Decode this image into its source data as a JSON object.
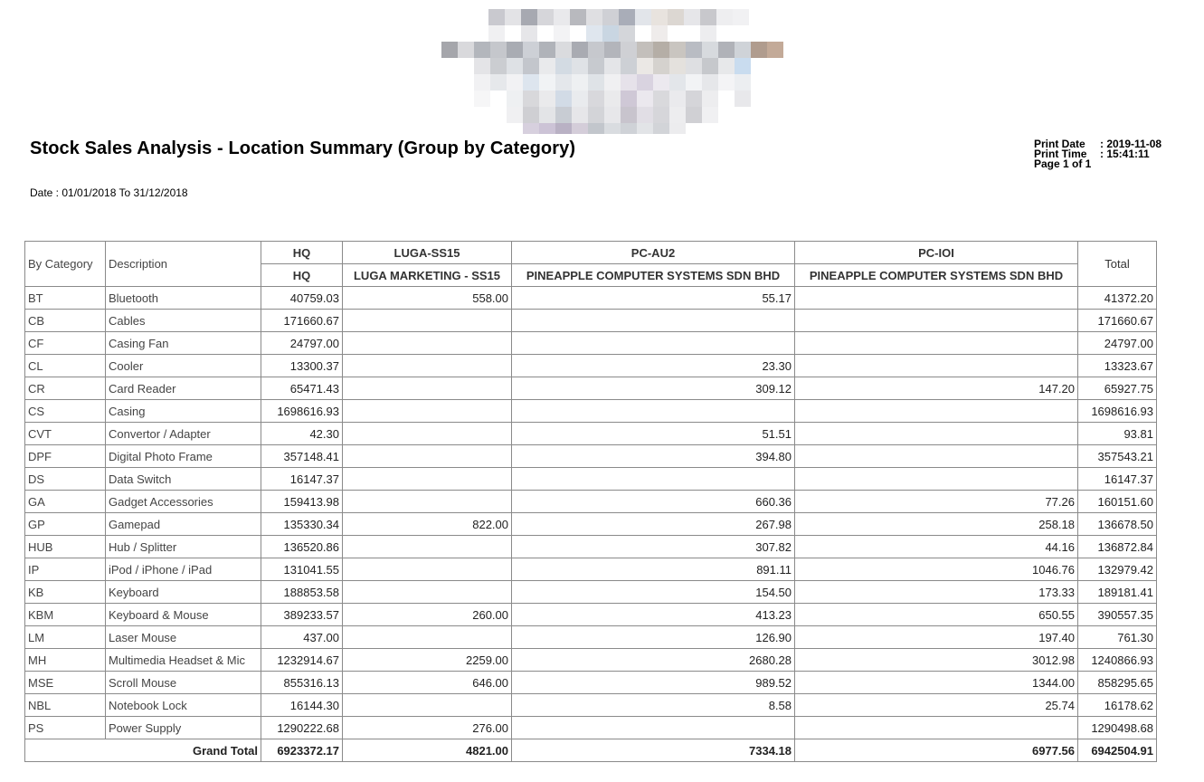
{
  "report": {
    "title": "Stock Sales Analysis - Location Summary (Group by Category)",
    "date_range": "Date : 01/01/2018 To 31/12/2018",
    "print_date_label": "Print Date",
    "print_date_value": ": 2019-11-08",
    "print_time_label": "Print Time",
    "print_time_value": ": 15:41:11",
    "page": "Page 1 of 1"
  },
  "table": {
    "col_category": "By Category",
    "col_description": "Description",
    "col_total": "Total",
    "locations": [
      {
        "code": "HQ",
        "name": "HQ"
      },
      {
        "code": "LUGA-SS15",
        "name": "LUGA MARKETING - SS15"
      },
      {
        "code": "PC-AU2",
        "name": "PINEAPPLE COMPUTER SYSTEMS SDN BHD"
      },
      {
        "code": "PC-IOI",
        "name": "PINEAPPLE COMPUTER SYSTEMS SDN BHD"
      }
    ],
    "rows": [
      {
        "code": "BT",
        "desc": "Bluetooth",
        "hq": "40759.03",
        "luga": "558.00",
        "au2": "55.17",
        "ioi": "",
        "total": "41372.20"
      },
      {
        "code": "CB",
        "desc": "Cables",
        "hq": "171660.67",
        "luga": "",
        "au2": "",
        "ioi": "",
        "total": "171660.67"
      },
      {
        "code": "CF",
        "desc": "Casing Fan",
        "hq": "24797.00",
        "luga": "",
        "au2": "",
        "ioi": "",
        "total": "24797.00"
      },
      {
        "code": "CL",
        "desc": "Cooler",
        "hq": "13300.37",
        "luga": "",
        "au2": "23.30",
        "ioi": "",
        "total": "13323.67"
      },
      {
        "code": "CR",
        "desc": "Card Reader",
        "hq": "65471.43",
        "luga": "",
        "au2": "309.12",
        "ioi": "147.20",
        "total": "65927.75"
      },
      {
        "code": "CS",
        "desc": "Casing",
        "hq": "1698616.93",
        "luga": "",
        "au2": "",
        "ioi": "",
        "total": "1698616.93"
      },
      {
        "code": "CVT",
        "desc": "Convertor / Adapter",
        "hq": "42.30",
        "luga": "",
        "au2": "51.51",
        "ioi": "",
        "total": "93.81"
      },
      {
        "code": "DPF",
        "desc": "Digital Photo Frame",
        "hq": "357148.41",
        "luga": "",
        "au2": "394.80",
        "ioi": "",
        "total": "357543.21"
      },
      {
        "code": "DS",
        "desc": "Data Switch",
        "hq": "16147.37",
        "luga": "",
        "au2": "",
        "ioi": "",
        "total": "16147.37"
      },
      {
        "code": "GA",
        "desc": "Gadget Accessories",
        "hq": "159413.98",
        "luga": "",
        "au2": "660.36",
        "ioi": "77.26",
        "total": "160151.60"
      },
      {
        "code": "GP",
        "desc": "Gamepad",
        "hq": "135330.34",
        "luga": "822.00",
        "au2": "267.98",
        "ioi": "258.18",
        "total": "136678.50"
      },
      {
        "code": "HUB",
        "desc": "Hub / Splitter",
        "hq": "136520.86",
        "luga": "",
        "au2": "307.82",
        "ioi": "44.16",
        "total": "136872.84"
      },
      {
        "code": "IP",
        "desc": "iPod / iPhone / iPad",
        "hq": "131041.55",
        "luga": "",
        "au2": "891.11",
        "ioi": "1046.76",
        "total": "132979.42"
      },
      {
        "code": "KB",
        "desc": "Keyboard",
        "hq": "188853.58",
        "luga": "",
        "au2": "154.50",
        "ioi": "173.33",
        "total": "189181.41"
      },
      {
        "code": "KBM",
        "desc": "Keyboard & Mouse",
        "hq": "389233.57",
        "luga": "260.00",
        "au2": "413.23",
        "ioi": "650.55",
        "total": "390557.35"
      },
      {
        "code": "LM",
        "desc": "Laser Mouse",
        "hq": "437.00",
        "luga": "",
        "au2": "126.90",
        "ioi": "197.40",
        "total": "761.30"
      },
      {
        "code": "MH",
        "desc": "Multimedia Headset & Mic",
        "hq": "1232914.67",
        "luga": "2259.00",
        "au2": "2680.28",
        "ioi": "3012.98",
        "total": "1240866.93"
      },
      {
        "code": "MSE",
        "desc": "Scroll Mouse",
        "hq": "855316.13",
        "luga": "646.00",
        "au2": "989.52",
        "ioi": "1344.00",
        "total": "858295.65"
      },
      {
        "code": "NBL",
        "desc": "Notebook Lock",
        "hq": "16144.30",
        "luga": "",
        "au2": "8.58",
        "ioi": "25.74",
        "total": "16178.62"
      },
      {
        "code": "PS",
        "desc": "Power Supply",
        "hq": "1290222.68",
        "luga": "276.00",
        "au2": "",
        "ioi": "",
        "total": "1290498.68"
      }
    ],
    "grand_total": {
      "label": "Grand Total",
      "hq": "6923372.17",
      "luga": "4821.00",
      "au2": "7334.18",
      "ioi": "6977.56",
      "total": "6942504.91"
    }
  }
}
